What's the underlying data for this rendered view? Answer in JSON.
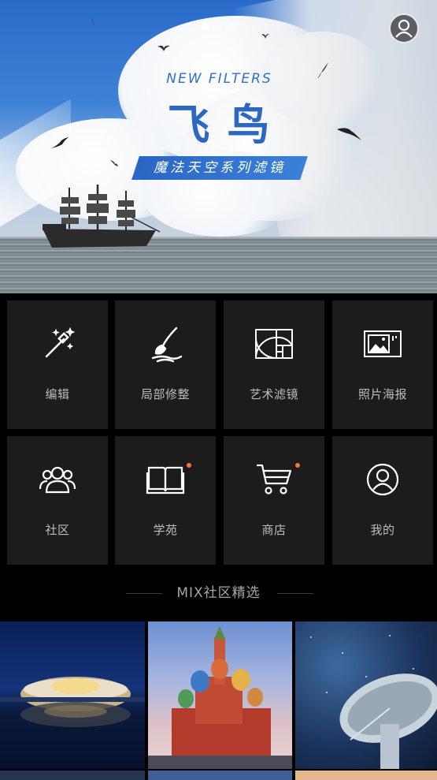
{
  "banner": {
    "subtitle_en": "NEW FILTERS",
    "title": "飞鸟",
    "ribbon": "魔法天空系列滤镜",
    "dots": [
      true,
      false,
      false
    ]
  },
  "grid": [
    {
      "label": "编辑",
      "icon": "magic-wand-icon",
      "badge": false
    },
    {
      "label": "局部修整",
      "icon": "brush-icon",
      "badge": false
    },
    {
      "label": "艺术滤镜",
      "icon": "golden-ratio-icon",
      "badge": false
    },
    {
      "label": "照片海报",
      "icon": "poster-icon",
      "badge": false
    },
    {
      "label": "社区",
      "icon": "community-icon",
      "badge": false
    },
    {
      "label": "学苑",
      "icon": "book-icon",
      "badge": true
    },
    {
      "label": "商店",
      "icon": "cart-icon",
      "badge": true
    },
    {
      "label": "我的",
      "icon": "profile-icon",
      "badge": false
    }
  ],
  "section": {
    "title": "MIX社区精选"
  },
  "colors": {
    "accent": "#2c67c1",
    "badge": "#f07a3a",
    "tile": "#1c1c1c",
    "background": "#000000"
  }
}
